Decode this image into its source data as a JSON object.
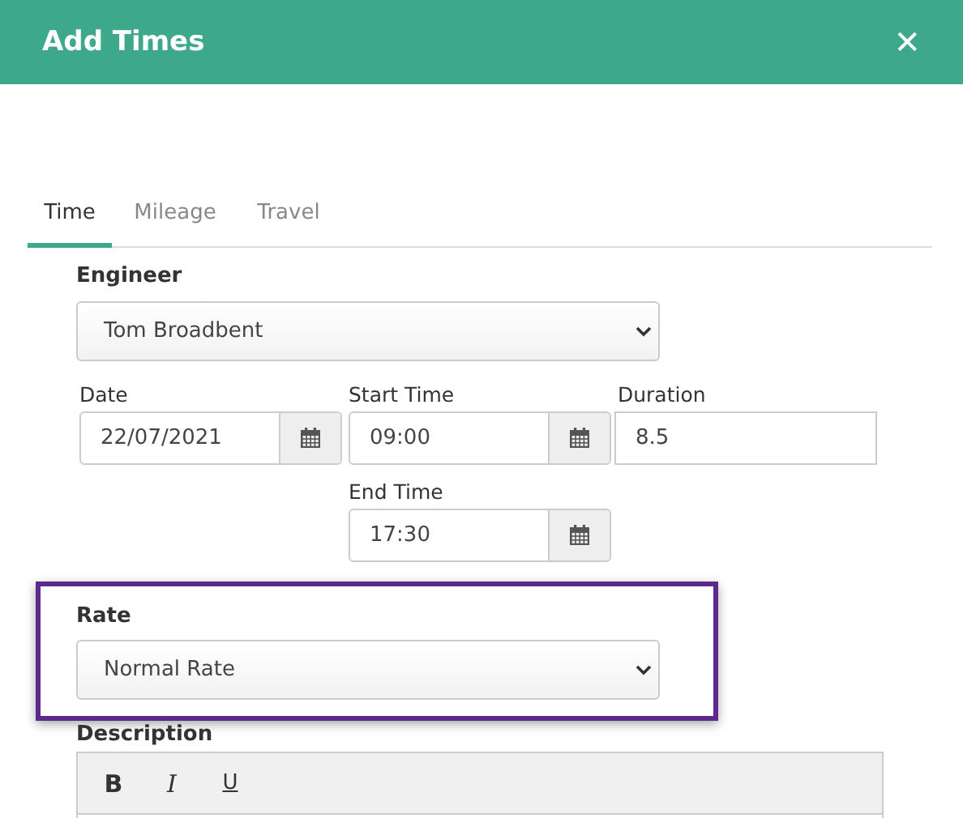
{
  "dialog": {
    "title": "Add Times",
    "close": "✕"
  },
  "tabs": [
    {
      "label": "Time",
      "selected": true
    },
    {
      "label": "Mileage",
      "selected": false
    },
    {
      "label": "Travel",
      "selected": false
    }
  ],
  "engineer": {
    "label": "Engineer",
    "value": "Tom Broadbent"
  },
  "date": {
    "label": "Date",
    "value": "22/07/2021"
  },
  "start_time": {
    "label": "Start Time",
    "value": "09:00"
  },
  "duration": {
    "label": "Duration",
    "value": "8.5"
  },
  "end_time": {
    "label": "End Time",
    "value": "17:30"
  },
  "rate": {
    "label": "Rate",
    "value": "Normal Rate",
    "highlighted": true
  },
  "description": {
    "label": "Description",
    "toolbar": [
      {
        "label": "B",
        "kind": "bold"
      },
      {
        "label": "I",
        "kind": "italic"
      },
      {
        "label": "U",
        "kind": "underline"
      }
    ]
  }
}
